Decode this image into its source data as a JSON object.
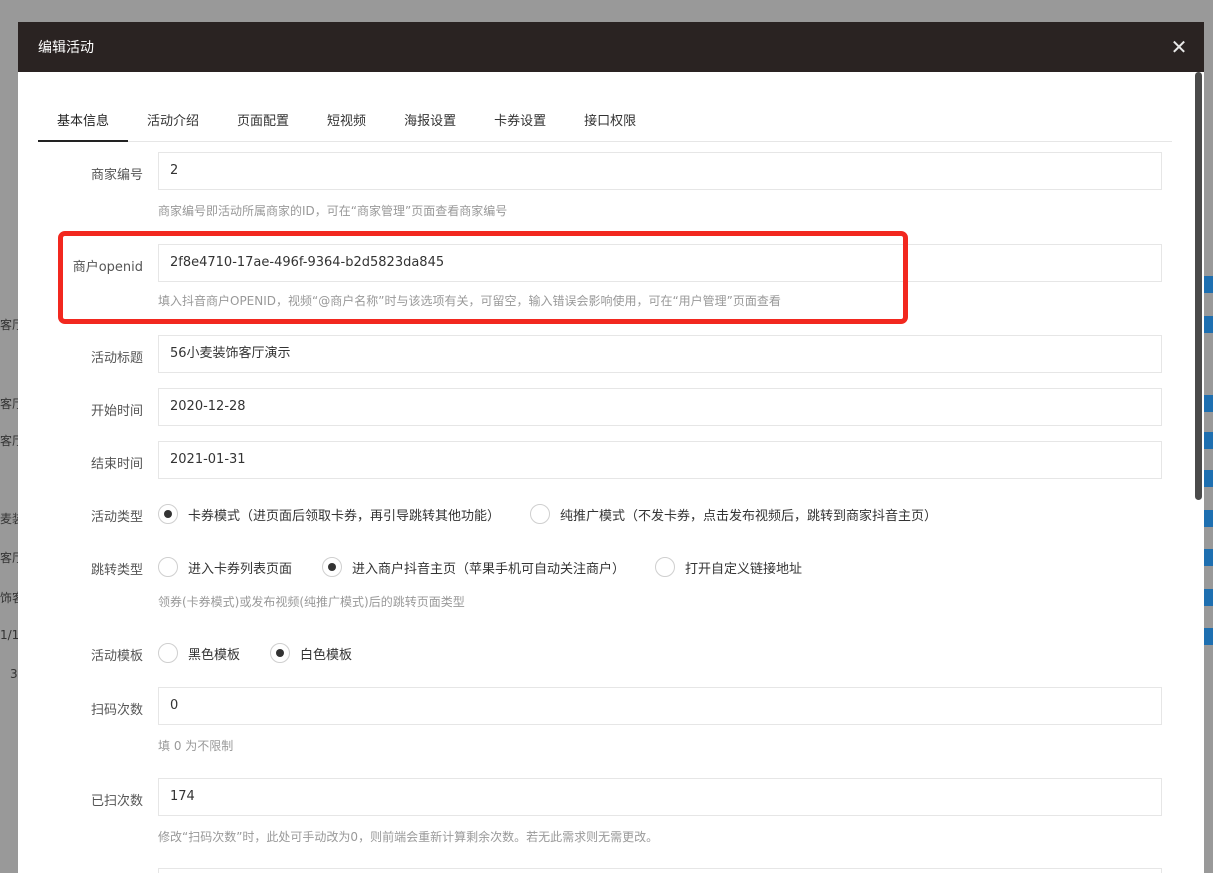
{
  "background": {
    "snippets": [
      "客厅",
      "客厅",
      "客厅",
      "麦装",
      "客厅",
      "饰客",
      "1/1",
      "3"
    ]
  },
  "modal": {
    "title": "编辑活动",
    "close_glyph": "✕"
  },
  "tabs": [
    "基本信息",
    "活动介绍",
    "页面配置",
    "短视频",
    "海报设置",
    "卡券设置",
    "接口权限"
  ],
  "form": {
    "merchant_no": {
      "label": "商家编号",
      "value": "2",
      "hint": "商家编号即活动所属商家的ID，可在“商家管理”页面查看商家编号"
    },
    "openid": {
      "label": "商户openid",
      "value": "2f8e4710-17ae-496f-9364-b2d5823da845",
      "hint": "填入抖音商户OPENID，视频“@商户名称”时与该选项有关，可留空，输入错误会影响使用，可在“用户管理”页面查看"
    },
    "title": {
      "label": "活动标题",
      "value": "56小麦装饰客厅演示"
    },
    "start_time": {
      "label": "开始时间",
      "value": "2020-12-28"
    },
    "end_time": {
      "label": "结束时间",
      "value": "2021-01-31"
    },
    "activity_type": {
      "label": "活动类型",
      "options": [
        "卡券模式（进页面后领取卡券，再引导跳转其他功能）",
        "纯推广模式（不发卡券，点击发布视频后，跳转到商家抖音主页）"
      ],
      "selected": 0
    },
    "jump_type": {
      "label": "跳转类型",
      "options": [
        "进入卡券列表页面",
        "进入商户抖音主页（苹果手机可自动关注商户）",
        "打开自定义链接地址"
      ],
      "selected": 1,
      "hint": "领券(卡券模式)或发布视频(纯推广模式)后的跳转页面类型"
    },
    "template": {
      "label": "活动模板",
      "options": [
        "黑色模板",
        "白色模板"
      ],
      "selected": 1
    },
    "scan_count": {
      "label": "扫码次数",
      "value": "0",
      "hint": "填 0 为不限制"
    },
    "scanned_count": {
      "label": "已扫次数",
      "value": "174",
      "hint": "修改“扫码次数”时，此处可手动改为0，则前端会重新计算剩余次数。若无此需求则无需更改。"
    }
  },
  "colors": {
    "header_bg": "#2a2322",
    "highlight": "#f2281f",
    "accent_blue": "#1e6fb0"
  }
}
